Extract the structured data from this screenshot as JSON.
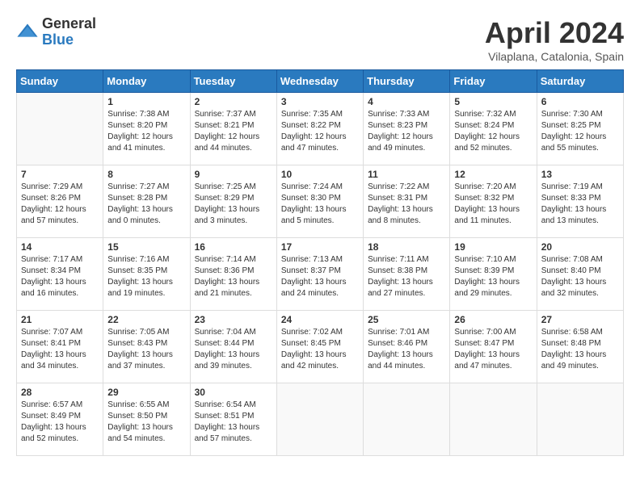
{
  "header": {
    "logo_general": "General",
    "logo_blue": "Blue",
    "month_title": "April 2024",
    "location": "Vilaplana, Catalonia, Spain"
  },
  "days_of_week": [
    "Sunday",
    "Monday",
    "Tuesday",
    "Wednesday",
    "Thursday",
    "Friday",
    "Saturday"
  ],
  "weeks": [
    [
      {
        "day": "",
        "sunrise": "",
        "sunset": "",
        "daylight": ""
      },
      {
        "day": "1",
        "sunrise": "Sunrise: 7:38 AM",
        "sunset": "Sunset: 8:20 PM",
        "daylight": "Daylight: 12 hours and 41 minutes."
      },
      {
        "day": "2",
        "sunrise": "Sunrise: 7:37 AM",
        "sunset": "Sunset: 8:21 PM",
        "daylight": "Daylight: 12 hours and 44 minutes."
      },
      {
        "day": "3",
        "sunrise": "Sunrise: 7:35 AM",
        "sunset": "Sunset: 8:22 PM",
        "daylight": "Daylight: 12 hours and 47 minutes."
      },
      {
        "day": "4",
        "sunrise": "Sunrise: 7:33 AM",
        "sunset": "Sunset: 8:23 PM",
        "daylight": "Daylight: 12 hours and 49 minutes."
      },
      {
        "day": "5",
        "sunrise": "Sunrise: 7:32 AM",
        "sunset": "Sunset: 8:24 PM",
        "daylight": "Daylight: 12 hours and 52 minutes."
      },
      {
        "day": "6",
        "sunrise": "Sunrise: 7:30 AM",
        "sunset": "Sunset: 8:25 PM",
        "daylight": "Daylight: 12 hours and 55 minutes."
      }
    ],
    [
      {
        "day": "7",
        "sunrise": "Sunrise: 7:29 AM",
        "sunset": "Sunset: 8:26 PM",
        "daylight": "Daylight: 12 hours and 57 minutes."
      },
      {
        "day": "8",
        "sunrise": "Sunrise: 7:27 AM",
        "sunset": "Sunset: 8:28 PM",
        "daylight": "Daylight: 13 hours and 0 minutes."
      },
      {
        "day": "9",
        "sunrise": "Sunrise: 7:25 AM",
        "sunset": "Sunset: 8:29 PM",
        "daylight": "Daylight: 13 hours and 3 minutes."
      },
      {
        "day": "10",
        "sunrise": "Sunrise: 7:24 AM",
        "sunset": "Sunset: 8:30 PM",
        "daylight": "Daylight: 13 hours and 5 minutes."
      },
      {
        "day": "11",
        "sunrise": "Sunrise: 7:22 AM",
        "sunset": "Sunset: 8:31 PM",
        "daylight": "Daylight: 13 hours and 8 minutes."
      },
      {
        "day": "12",
        "sunrise": "Sunrise: 7:20 AM",
        "sunset": "Sunset: 8:32 PM",
        "daylight": "Daylight: 13 hours and 11 minutes."
      },
      {
        "day": "13",
        "sunrise": "Sunrise: 7:19 AM",
        "sunset": "Sunset: 8:33 PM",
        "daylight": "Daylight: 13 hours and 13 minutes."
      }
    ],
    [
      {
        "day": "14",
        "sunrise": "Sunrise: 7:17 AM",
        "sunset": "Sunset: 8:34 PM",
        "daylight": "Daylight: 13 hours and 16 minutes."
      },
      {
        "day": "15",
        "sunrise": "Sunrise: 7:16 AM",
        "sunset": "Sunset: 8:35 PM",
        "daylight": "Daylight: 13 hours and 19 minutes."
      },
      {
        "day": "16",
        "sunrise": "Sunrise: 7:14 AM",
        "sunset": "Sunset: 8:36 PM",
        "daylight": "Daylight: 13 hours and 21 minutes."
      },
      {
        "day": "17",
        "sunrise": "Sunrise: 7:13 AM",
        "sunset": "Sunset: 8:37 PM",
        "daylight": "Daylight: 13 hours and 24 minutes."
      },
      {
        "day": "18",
        "sunrise": "Sunrise: 7:11 AM",
        "sunset": "Sunset: 8:38 PM",
        "daylight": "Daylight: 13 hours and 27 minutes."
      },
      {
        "day": "19",
        "sunrise": "Sunrise: 7:10 AM",
        "sunset": "Sunset: 8:39 PM",
        "daylight": "Daylight: 13 hours and 29 minutes."
      },
      {
        "day": "20",
        "sunrise": "Sunrise: 7:08 AM",
        "sunset": "Sunset: 8:40 PM",
        "daylight": "Daylight: 13 hours and 32 minutes."
      }
    ],
    [
      {
        "day": "21",
        "sunrise": "Sunrise: 7:07 AM",
        "sunset": "Sunset: 8:41 PM",
        "daylight": "Daylight: 13 hours and 34 minutes."
      },
      {
        "day": "22",
        "sunrise": "Sunrise: 7:05 AM",
        "sunset": "Sunset: 8:43 PM",
        "daylight": "Daylight: 13 hours and 37 minutes."
      },
      {
        "day": "23",
        "sunrise": "Sunrise: 7:04 AM",
        "sunset": "Sunset: 8:44 PM",
        "daylight": "Daylight: 13 hours and 39 minutes."
      },
      {
        "day": "24",
        "sunrise": "Sunrise: 7:02 AM",
        "sunset": "Sunset: 8:45 PM",
        "daylight": "Daylight: 13 hours and 42 minutes."
      },
      {
        "day": "25",
        "sunrise": "Sunrise: 7:01 AM",
        "sunset": "Sunset: 8:46 PM",
        "daylight": "Daylight: 13 hours and 44 minutes."
      },
      {
        "day": "26",
        "sunrise": "Sunrise: 7:00 AM",
        "sunset": "Sunset: 8:47 PM",
        "daylight": "Daylight: 13 hours and 47 minutes."
      },
      {
        "day": "27",
        "sunrise": "Sunrise: 6:58 AM",
        "sunset": "Sunset: 8:48 PM",
        "daylight": "Daylight: 13 hours and 49 minutes."
      }
    ],
    [
      {
        "day": "28",
        "sunrise": "Sunrise: 6:57 AM",
        "sunset": "Sunset: 8:49 PM",
        "daylight": "Daylight: 13 hours and 52 minutes."
      },
      {
        "day": "29",
        "sunrise": "Sunrise: 6:55 AM",
        "sunset": "Sunset: 8:50 PM",
        "daylight": "Daylight: 13 hours and 54 minutes."
      },
      {
        "day": "30",
        "sunrise": "Sunrise: 6:54 AM",
        "sunset": "Sunset: 8:51 PM",
        "daylight": "Daylight: 13 hours and 57 minutes."
      },
      {
        "day": "",
        "sunrise": "",
        "sunset": "",
        "daylight": ""
      },
      {
        "day": "",
        "sunrise": "",
        "sunset": "",
        "daylight": ""
      },
      {
        "day": "",
        "sunrise": "",
        "sunset": "",
        "daylight": ""
      },
      {
        "day": "",
        "sunrise": "",
        "sunset": "",
        "daylight": ""
      }
    ]
  ]
}
